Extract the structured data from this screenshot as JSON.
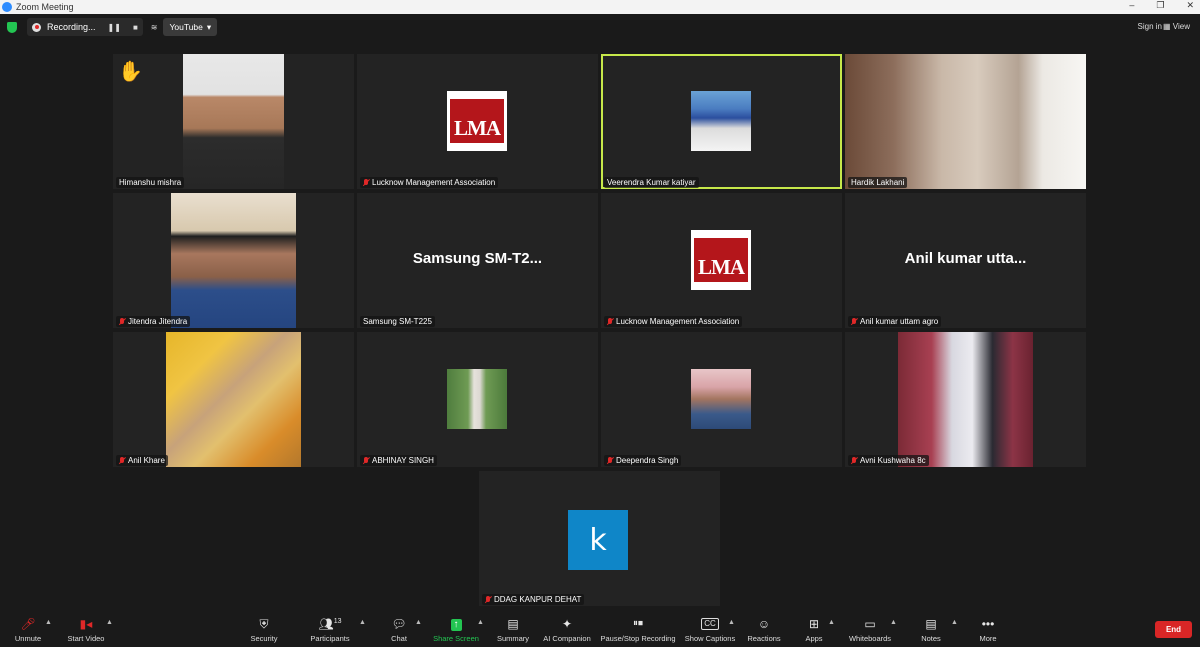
{
  "window": {
    "title": "Zoom Meeting",
    "controls": [
      "–",
      "❐",
      "✕"
    ]
  },
  "topbar": {
    "recording_label": "Recording...",
    "pause_glyph": "❚❚",
    "stop_glyph": "■",
    "stream_glyph": "≋",
    "youtube_label": "YouTube",
    "sign_in": "Sign in",
    "view_label": "View"
  },
  "tiles": [
    {
      "name": "Himanshu mishra",
      "muted": false,
      "content": "photo",
      "raised_hand": true
    },
    {
      "name": "Lucknow Management Association",
      "muted": true,
      "content": "lma-logo"
    },
    {
      "name": "Veerendra Kumar katiyar",
      "muted": false,
      "content": "photo",
      "speaking": true
    },
    {
      "name": "Hardik Lakhani",
      "muted": false,
      "content": "photo"
    },
    {
      "name": "Jitendra Jitendra",
      "muted": true,
      "content": "photo"
    },
    {
      "name": "Samsung SM-T225",
      "display": "Samsung  SM-T2...",
      "muted": false,
      "content": "name"
    },
    {
      "name": "Lucknow Management Association",
      "muted": true,
      "content": "lma-logo"
    },
    {
      "name": "Anil kumar uttam agro",
      "display": "Anil kumar utta...",
      "muted": true,
      "content": "name"
    },
    {
      "name": "Anil Khare",
      "muted": true,
      "content": "photo"
    },
    {
      "name": "ABHINAY SINGH",
      "muted": true,
      "content": "photo"
    },
    {
      "name": "Deependra Singh",
      "muted": true,
      "content": "photo"
    },
    {
      "name": "Avni Kushwaha 8c",
      "muted": true,
      "content": "photo"
    },
    {
      "name": "DDAG KANPUR DEHAT",
      "muted": true,
      "content": "avatar",
      "avatar_letter": "k"
    }
  ],
  "lma_logo_text": "LMA",
  "toolbar": {
    "unmute": "Unmute",
    "start_video": "Start Video",
    "security": "Security",
    "participants": "Participants",
    "participant_count": "13",
    "chat": "Chat",
    "share_screen": "Share Screen",
    "summary": "Summary",
    "ai_companion": "AI Companion",
    "pause_stop_recording": "Pause/Stop Recording",
    "show_captions": "Show Captions",
    "cc_glyph": "CC",
    "reactions": "Reactions",
    "apps": "Apps",
    "whiteboards": "Whiteboards",
    "notes": "Notes",
    "more": "More",
    "end": "End"
  },
  "colors": {
    "background": "#1a1a1a",
    "tile": "#232323",
    "speaker_outline": "#c6e84a",
    "end_button": "#d92626",
    "share_green": "#23c552",
    "muted_red": "#e02828"
  }
}
